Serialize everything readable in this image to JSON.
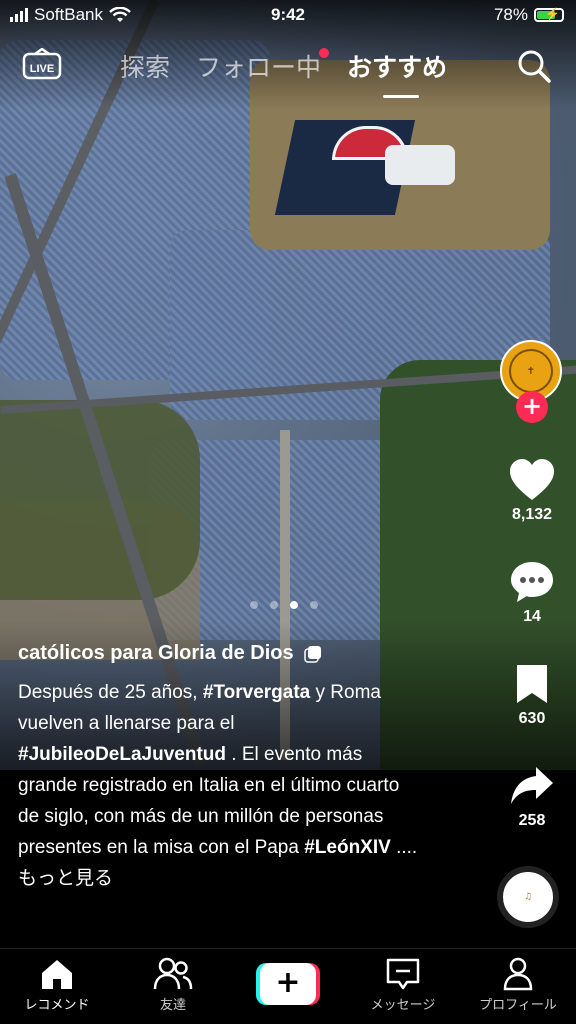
{
  "status_bar": {
    "carrier": "SoftBank",
    "time": "9:42",
    "battery": "78%"
  },
  "top_nav": {
    "live_label": "LIVE",
    "tabs": [
      {
        "label": "探索"
      },
      {
        "label": "フォロー中"
      },
      {
        "label": "おすすめ"
      }
    ],
    "active_tab": "おすすめ"
  },
  "video": {
    "author": "católicos para Gloria de Dios",
    "description_1": "Después de 25 años, ",
    "hashtag_1": "#Torvergata",
    "description_2": " y Roma vuelven a llenarse para el ",
    "hashtag_2": "#JubileoDeLaJuventud",
    "description_3": " . El evento más grande registrado en Italia en el último cuarto de siglo, con más de un millón de personas presentes en la misa con el Papa ",
    "hashtag_3": "#LeónXIV",
    "ellipsis": " .... ",
    "more_label": "もっと見る",
    "slide_count": 4,
    "active_slide": 3
  },
  "actions": {
    "likes": "8,132",
    "comments": "14",
    "bookmarks": "630",
    "shares": "258",
    "follow_symbol": "+"
  },
  "bottom_nav": {
    "items": [
      {
        "label": "レコメンド"
      },
      {
        "label": "友達"
      },
      {
        "label": ""
      },
      {
        "label": "メッセージ"
      },
      {
        "label": "プロフィール"
      }
    ],
    "plus_symbol": "+"
  },
  "colors": {
    "accent": "#fe2c55",
    "cyan": "#25f4ee",
    "battery": "#3bd14b"
  }
}
